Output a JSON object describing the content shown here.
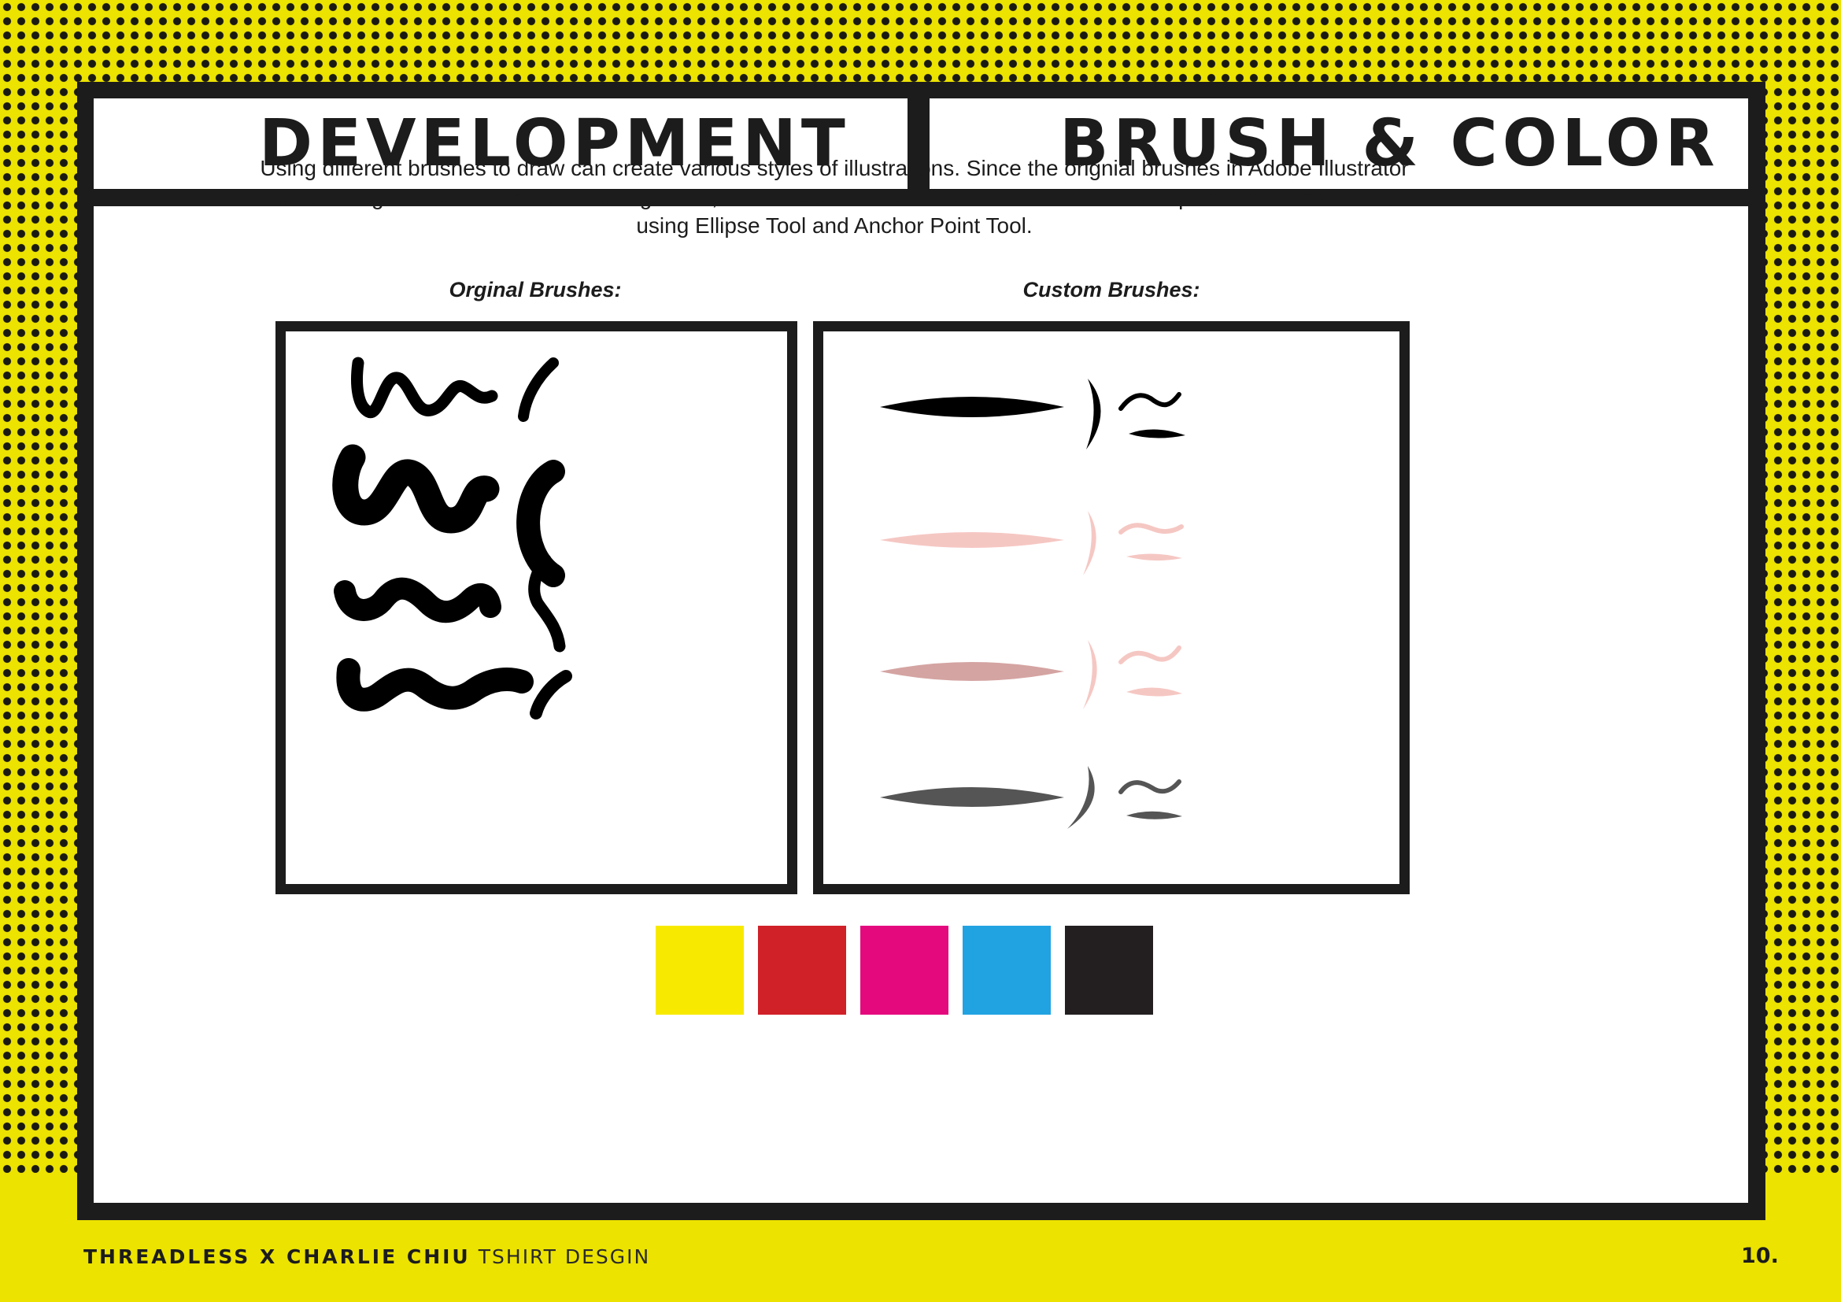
{
  "header": {
    "left_title": "DEVELOPMENT",
    "right_title": "BRUSH & COLOR"
  },
  "intro": {
    "line1": "Using different brushes to draw can create various styles of illustrations. Since the orignial brushes in Adobe Illustrator",
    "line2": "cannot bring the comic / line art drawing effect, I created a few new brushes with thin and sharp start and finish stroke",
    "line3": "using Ellipse Tool and Anchor Point Tool."
  },
  "panels": {
    "original_label": "Orginal Brushes:",
    "custom_label": "Custom Brushes:"
  },
  "brush_colors": {
    "original": "#000000",
    "custom": [
      "#000000",
      "#f5c7c3",
      "#d4a4a2",
      "#555555"
    ]
  },
  "palette": [
    {
      "name": "yellow",
      "color": "#f7ea00"
    },
    {
      "name": "red",
      "color": "#d02028"
    },
    {
      "name": "magenta",
      "color": "#e5097e"
    },
    {
      "name": "cyan",
      "color": "#21a3e2"
    },
    {
      "name": "black",
      "color": "#231f20"
    }
  ],
  "footer": {
    "brand": "THREADLESS X CHARLIE CHIU",
    "subtitle": "TSHIRT DESGIN",
    "page_number": "10."
  }
}
